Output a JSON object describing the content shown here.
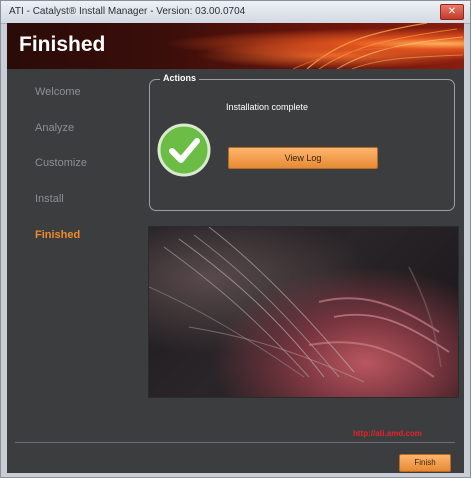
{
  "window": {
    "title": "ATI - Catalyst® Install Manager - Version: 03.00.0704"
  },
  "header": {
    "title": "Finished"
  },
  "sidebar": {
    "items": [
      {
        "label": "Welcome",
        "active": false
      },
      {
        "label": "Analyze",
        "active": false
      },
      {
        "label": "Customize",
        "active": false
      },
      {
        "label": "Install",
        "active": false
      },
      {
        "label": "Finished",
        "active": true
      }
    ]
  },
  "actions": {
    "legend": "Actions",
    "status_text": "Installation complete",
    "view_log_label": "View Log"
  },
  "footer": {
    "url": "http://ati.amd.com",
    "finish_label": "Finish"
  },
  "icons": {
    "success": "check-icon",
    "close": "close-icon"
  },
  "colors": {
    "accent": "#f08a2c",
    "panel_bg": "#3c3d3f",
    "url_red": "#e4232b",
    "success_green": "#6bbd45"
  }
}
